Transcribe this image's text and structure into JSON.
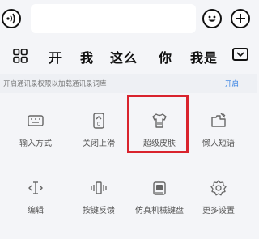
{
  "input": {
    "value": ""
  },
  "candidates": [
    "开",
    "我",
    "这么",
    "你",
    "我是"
  ],
  "banner": {
    "message": "开启通讯录权限以加载通讯录词库",
    "action": "开启"
  },
  "tools": [
    {
      "label": "输入方式",
      "icon": "keyboard-icon"
    },
    {
      "label": "关闭上滑",
      "icon": "swipe-up-icon"
    },
    {
      "label": "超级皮肤",
      "icon": "skin-shirt-icon"
    },
    {
      "label": "懒人短语",
      "icon": "quick-phrase-icon"
    },
    {
      "label": "编辑",
      "icon": "text-cursor-icon"
    },
    {
      "label": "按键反馈",
      "icon": "vibration-icon"
    },
    {
      "label": "仿真机械键盘",
      "icon": "mechanical-key-icon"
    },
    {
      "label": "更多设置",
      "icon": "gear-icon"
    }
  ],
  "colors": {
    "background": "#f4f5f8",
    "accent_link": "#2a7ae2",
    "highlight_box": "#d9232d"
  }
}
